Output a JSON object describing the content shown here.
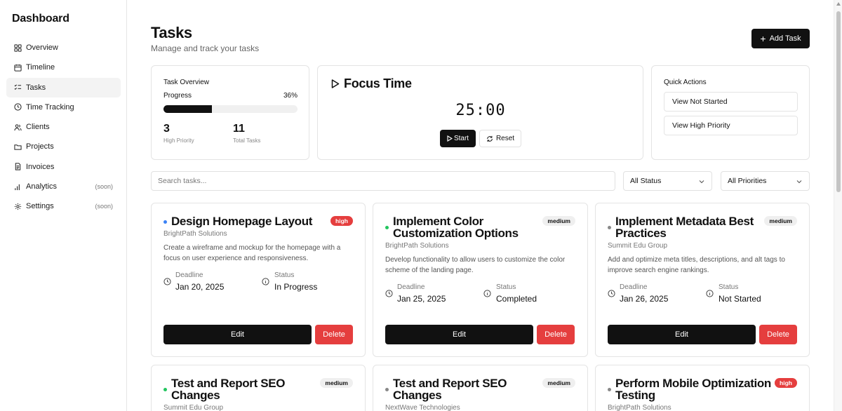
{
  "sidebar": {
    "brand": "Dashboard",
    "items": [
      {
        "label": "Overview",
        "icon": "grid-icon",
        "soon": ""
      },
      {
        "label": "Timeline",
        "icon": "calendar-icon",
        "soon": ""
      },
      {
        "label": "Tasks",
        "icon": "list-check-icon",
        "soon": "",
        "active": true
      },
      {
        "label": "Time Tracking",
        "icon": "clock-icon",
        "soon": ""
      },
      {
        "label": "Clients",
        "icon": "users-icon",
        "soon": ""
      },
      {
        "label": "Projects",
        "icon": "folder-icon",
        "soon": ""
      },
      {
        "label": "Invoices",
        "icon": "document-icon",
        "soon": ""
      },
      {
        "label": "Analytics",
        "icon": "bar-chart-icon",
        "soon": "(soon)"
      },
      {
        "label": "Settings",
        "icon": "gear-icon",
        "soon": "(soon)"
      }
    ]
  },
  "header": {
    "title": "Tasks",
    "subtitle": "Manage and track your tasks",
    "add_label": "Add Task"
  },
  "overview": {
    "title": "Task Overview",
    "progress_label": "Progress",
    "progress_value": "36%",
    "progress_fraction": 0.36,
    "high_priority_count": "3",
    "high_priority_label": "High Priority",
    "total_count": "11",
    "total_label": "Total Tasks"
  },
  "focus": {
    "title": "Focus Time",
    "timer": "25:00",
    "start_label": "Start",
    "reset_label": "Reset"
  },
  "quick_actions": {
    "title": "Quick Actions",
    "items": [
      "View Not Started",
      "View High Priority"
    ]
  },
  "filters": {
    "search_placeholder": "Search tasks...",
    "status": "All Status",
    "priority": "All Priorities"
  },
  "tasks": [
    {
      "title": "Design Homepage Layout",
      "priority": "high",
      "client": "BrightPath Solutions",
      "description": "Create a wireframe and mockup for the homepage with a focus on user experience and responsiveness.",
      "deadline_label": "Deadline",
      "deadline": "Jan 20, 2025",
      "status_label": "Status",
      "status": "In Progress",
      "dot_color": "#3b82f6",
      "edit": "Edit",
      "delete": "Delete"
    },
    {
      "title": "Implement Color Customization Options",
      "priority": "medium",
      "client": "BrightPath Solutions",
      "description": "Develop functionality to allow users to customize the color scheme of the landing page.",
      "deadline_label": "Deadline",
      "deadline": "Jan 25, 2025",
      "status_label": "Status",
      "status": "Completed",
      "dot_color": "#22c55e",
      "edit": "Edit",
      "delete": "Delete"
    },
    {
      "title": "Implement Metadata Best Practices",
      "priority": "medium",
      "client": "Summit Edu Group",
      "description": "Add and optimize meta titles, descriptions, and alt tags to improve search engine rankings.",
      "deadline_label": "Deadline",
      "deadline": "Jan 26, 2025",
      "status_label": "Status",
      "status": "Not Started",
      "dot_color": "#888888",
      "edit": "Edit",
      "delete": "Delete"
    },
    {
      "title": "Test and Report SEO Changes",
      "priority": "medium",
      "client": "Summit Edu Group",
      "dot_color": "#22c55e"
    },
    {
      "title": "Test and Report SEO Changes",
      "priority": "medium",
      "client": "NextWave Technologies",
      "dot_color": "#888888"
    },
    {
      "title": "Perform Mobile Optimization Testing",
      "priority": "high",
      "client": "BrightPath Solutions",
      "dot_color": "#888888"
    }
  ],
  "colors": {
    "accent": "#111111",
    "danger": "#e53e3e",
    "progress_track": "#f0f0f0"
  }
}
